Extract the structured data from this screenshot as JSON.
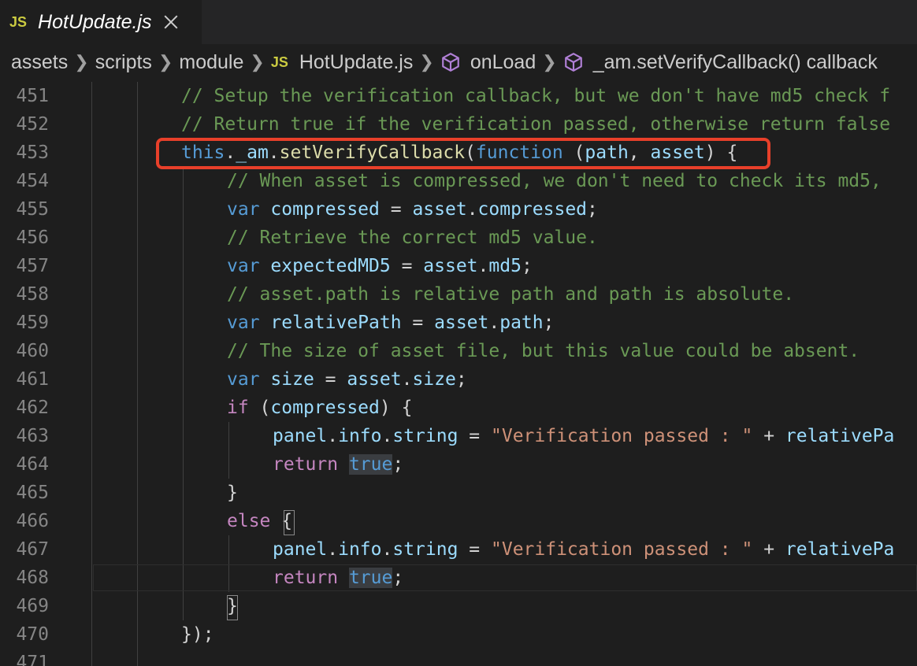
{
  "tab": {
    "badge": "JS",
    "title": "HotUpdate.js"
  },
  "breadcrumb": {
    "items": [
      "assets",
      "scripts",
      "module",
      "HotUpdate.js",
      "onLoad",
      "_am.setVerifyCallback() callback"
    ],
    "js_badge": "JS",
    "icons": [
      "chevron-right-icon",
      "js-file-icon",
      "method-cube-icon"
    ]
  },
  "editor": {
    "lines": [
      {
        "n": "451",
        "t": [
          [
            "cm",
            "// Setup the verification callback, but we don't have md5 check f"
          ]
        ]
      },
      {
        "n": "452",
        "t": [
          [
            "cm",
            "// Return true if the verification passed, otherwise return false"
          ]
        ]
      },
      {
        "n": "453",
        "t": [
          [
            "kw",
            "this"
          ],
          [
            "pn",
            "."
          ],
          [
            "var",
            "_am"
          ],
          [
            "pn",
            "."
          ],
          [
            "fn",
            "setVerifyCallback"
          ],
          [
            "pn",
            "("
          ],
          [
            "kw",
            "function"
          ],
          [
            "pn",
            " ("
          ],
          [
            "var",
            "path"
          ],
          [
            "pn",
            ", "
          ],
          [
            "var",
            "asset"
          ],
          [
            "pn",
            ") {"
          ]
        ]
      },
      {
        "n": "454",
        "t": [
          [
            "cm",
            "// When asset is compressed, we don't need to check its md5,"
          ]
        ]
      },
      {
        "n": "455",
        "t": [
          [
            "kw",
            "var"
          ],
          [
            "pn",
            " "
          ],
          [
            "var",
            "compressed"
          ],
          [
            "pn",
            " = "
          ],
          [
            "var",
            "asset"
          ],
          [
            "pn",
            "."
          ],
          [
            "var",
            "compressed"
          ],
          [
            "pn",
            ";"
          ]
        ]
      },
      {
        "n": "456",
        "t": [
          [
            "cm",
            "// Retrieve the correct md5 value."
          ]
        ]
      },
      {
        "n": "457",
        "t": [
          [
            "kw",
            "var"
          ],
          [
            "pn",
            " "
          ],
          [
            "var",
            "expectedMD5"
          ],
          [
            "pn",
            " = "
          ],
          [
            "var",
            "asset"
          ],
          [
            "pn",
            "."
          ],
          [
            "var",
            "md5"
          ],
          [
            "pn",
            ";"
          ]
        ]
      },
      {
        "n": "458",
        "t": [
          [
            "cm",
            "// asset.path is relative path and path is absolute."
          ]
        ]
      },
      {
        "n": "459",
        "t": [
          [
            "kw",
            "var"
          ],
          [
            "pn",
            " "
          ],
          [
            "var",
            "relativePath"
          ],
          [
            "pn",
            " = "
          ],
          [
            "var",
            "asset"
          ],
          [
            "pn",
            "."
          ],
          [
            "var",
            "path"
          ],
          [
            "pn",
            ";"
          ]
        ]
      },
      {
        "n": "460",
        "t": [
          [
            "cm",
            "// The size of asset file, but this value could be absent."
          ]
        ]
      },
      {
        "n": "461",
        "t": [
          [
            "kw",
            "var"
          ],
          [
            "pn",
            " "
          ],
          [
            "var",
            "size"
          ],
          [
            "pn",
            " = "
          ],
          [
            "var",
            "asset"
          ],
          [
            "pn",
            "."
          ],
          [
            "var",
            "size"
          ],
          [
            "pn",
            ";"
          ]
        ]
      },
      {
        "n": "462",
        "t": [
          [
            "ctl",
            "if"
          ],
          [
            "pn",
            " ("
          ],
          [
            "var",
            "compressed"
          ],
          [
            "pn",
            ") {"
          ]
        ]
      },
      {
        "n": "463",
        "t": [
          [
            "var",
            "panel"
          ],
          [
            "pn",
            "."
          ],
          [
            "var",
            "info"
          ],
          [
            "pn",
            "."
          ],
          [
            "var",
            "string"
          ],
          [
            "pn",
            " = "
          ],
          [
            "str",
            "\"Verification passed : \""
          ],
          [
            "pn",
            " + "
          ],
          [
            "var",
            "relativePa"
          ]
        ]
      },
      {
        "n": "464",
        "t": [
          [
            "ctl",
            "return"
          ],
          [
            "pn",
            " "
          ],
          [
            "kwsel",
            "true"
          ],
          [
            "pn",
            ";"
          ]
        ]
      },
      {
        "n": "465",
        "t": [
          [
            "pn",
            "}"
          ]
        ]
      },
      {
        "n": "466",
        "t": [
          [
            "ctl",
            "else"
          ],
          [
            "pn",
            " {"
          ]
        ]
      },
      {
        "n": "467",
        "t": [
          [
            "var",
            "panel"
          ],
          [
            "pn",
            "."
          ],
          [
            "var",
            "info"
          ],
          [
            "pn",
            "."
          ],
          [
            "var",
            "string"
          ],
          [
            "pn",
            " = "
          ],
          [
            "str",
            "\"Verification passed : \""
          ],
          [
            "pn",
            " + "
          ],
          [
            "var",
            "relativePa"
          ]
        ]
      },
      {
        "n": "468",
        "t": [
          [
            "ctl",
            "return"
          ],
          [
            "pn",
            " "
          ],
          [
            "kwsel",
            "true"
          ],
          [
            "pn",
            ";"
          ]
        ]
      },
      {
        "n": "469",
        "t": [
          [
            "pn",
            "}"
          ]
        ]
      },
      {
        "n": "470",
        "t": [
          [
            "pn",
            "});"
          ]
        ]
      },
      {
        "n": "471",
        "t": []
      }
    ],
    "indents": [
      230,
      230,
      230,
      288,
      288,
      288,
      288,
      288,
      288,
      288,
      288,
      288,
      346,
      346,
      288,
      288,
      346,
      346,
      288,
      230,
      230
    ]
  },
  "colors": {
    "highlight_border": "#e8402a",
    "background": "#1e1e1e"
  }
}
